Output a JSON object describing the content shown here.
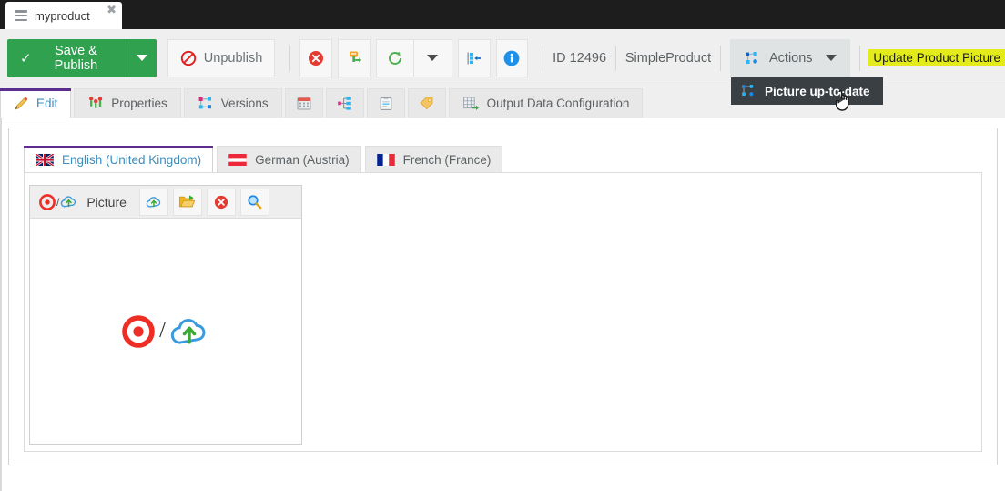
{
  "window": {
    "tab": {
      "label": "myproduct",
      "icon": "menu-icon",
      "close": "✖"
    }
  },
  "toolbar": {
    "save_publish_label": "Save & Publish",
    "save_publish_check": "✓",
    "unpublish_label": "Unpublish",
    "icons": [
      {
        "name": "delete-icon",
        "title": "Delete"
      },
      {
        "name": "permissions-key-icon",
        "title": "Permissions"
      },
      {
        "name": "reload-icon",
        "title": "Reload"
      },
      {
        "name": "reload-dropdown-icon",
        "title": "Reload options"
      },
      {
        "name": "move-icon",
        "title": "Move"
      },
      {
        "name": "info-icon",
        "title": "Info"
      }
    ],
    "id_label": "ID 12496",
    "type_label": "SimpleProduct",
    "actions_label": "Actions",
    "actions_icon": "versions-nodes-icon",
    "highlight_label": "Update Product Picture"
  },
  "dropdown": {
    "item_label": "Picture up-to-date",
    "item_icon": "versions-nodes-icon"
  },
  "tabs": [
    {
      "label": "Edit",
      "icon": "pencil-icon",
      "active": true
    },
    {
      "label": "Properties",
      "icon": "properties-icon",
      "active": false
    },
    {
      "label": "Versions",
      "icon": "versions-nodes-icon",
      "active": false
    },
    {
      "label": "",
      "icon": "calendar-icon",
      "active": false
    },
    {
      "label": "",
      "icon": "hierarchy-icon",
      "active": false
    },
    {
      "label": "",
      "icon": "clipboard-icon",
      "active": false
    },
    {
      "label": "",
      "icon": "tag-icon",
      "active": false
    },
    {
      "label": "Output Data Configuration",
      "icon": "grid-export-icon",
      "active": false
    }
  ],
  "languages": [
    {
      "label": "English (United Kingdom)",
      "flag": "uk-flag",
      "active": true
    },
    {
      "label": "German (Austria)",
      "flag": "austria-flag",
      "active": false
    },
    {
      "label": "French (France)",
      "flag": "france-flag",
      "active": false
    }
  ],
  "picture_widget": {
    "title": "Picture",
    "status_icons": [
      "target-icon",
      "cloud-upload-icon"
    ],
    "buttons": [
      {
        "name": "cloud-upload-button",
        "icon": "cloud-upload-icon"
      },
      {
        "name": "open-folder-button",
        "icon": "folder-open-icon"
      },
      {
        "name": "remove-button",
        "icon": "delete-icon"
      },
      {
        "name": "preview-button",
        "icon": "magnifier-icon"
      }
    ],
    "placeholder": {
      "left_icon": "target-icon",
      "separator": "/",
      "right_icon": "cloud-upload-icon"
    }
  },
  "colors": {
    "green_button": "#2fa14f",
    "accent_purple": "#5b2d8e",
    "active_tab_text": "#3c8dbc",
    "highlight_yellow": "#e3ec1a",
    "dropdown_bg": "#3a3f44",
    "target_red": "#ee2d24",
    "cloud_blue": "#3a9ae0",
    "arrow_green": "#3aaa35"
  }
}
